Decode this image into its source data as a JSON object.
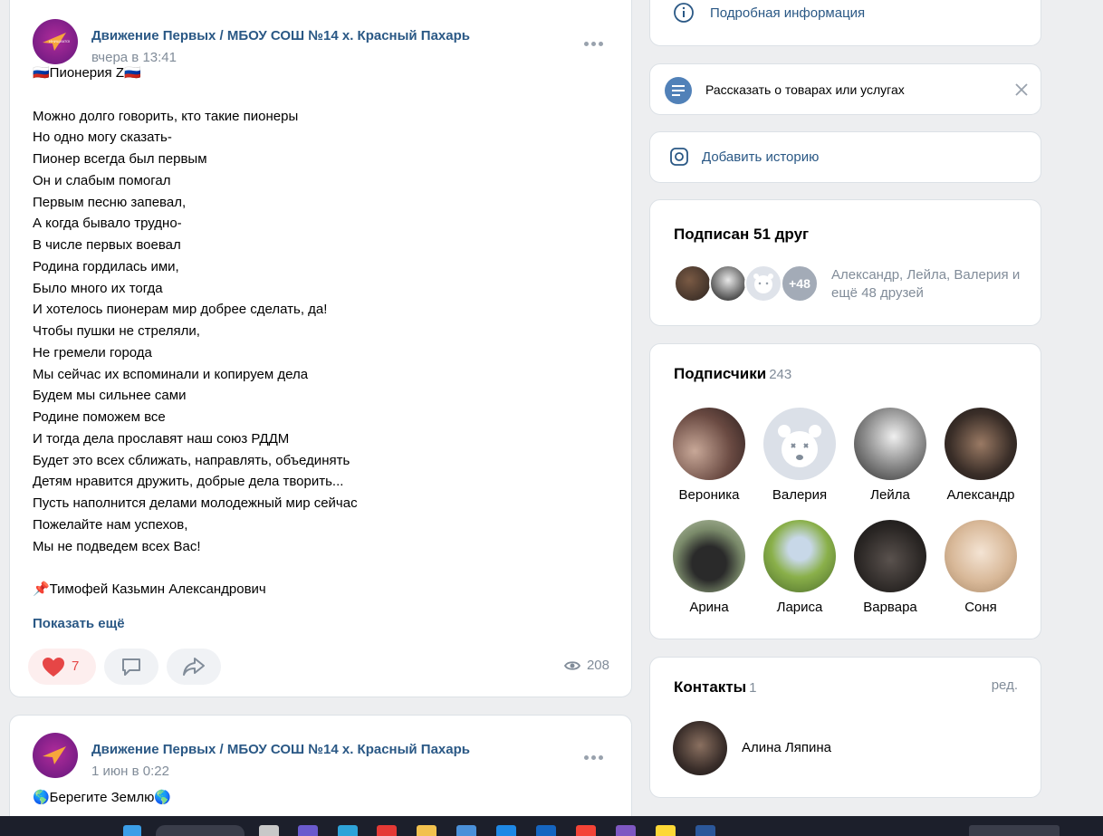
{
  "post1": {
    "group_name": "Движение Первых / МБОУ СОШ №14 х. Красный Пахарь",
    "time": "вчера в 13:41",
    "text": "🇷🇺Пионерия Z🇷🇺\n\nМожно долго говорить, кто такие пионеры\nНо одно могу сказать-\nПионер всегда был первым\nОн и слабым помогал\nПервым песню запевал,\nА когда бывало трудно-\nВ числе первых воевал\nРодина гордилась ими,\nБыло много их тогда\nИ хотелось пионерам мир добрее сделать, да!\nЧтобы пушки не стреляли,\nНе гремели города\nМы сейчас их вспоминали и копируем дела\nБудем мы сильнее сами\nРодине поможем все\nИ тогда дела прославят наш союз РДДМ\nБудет это всех сближать, направлять, объединять\nДетям нравится дружить, добрые дела творить...\nПусть наполнится делами молодежный мир сейчас\nПожелайте нам успехов,\nМы не подведем всех Вас!\n\n📌Тимофей Казьмин Александрович",
    "show_more": "Показать ещё",
    "likes": "7",
    "views": "208"
  },
  "post2": {
    "group_name": "Движение Первых / МБОУ СОШ №14 х. Красный Пахарь",
    "time": "1 июн в 0:22",
    "text": "🌎Берегите Землю🌎"
  },
  "sidebar": {
    "info_link": "Подробная информация",
    "promo_text": "Рассказать о товарах или услугах",
    "story_link": "Добавить историю",
    "friends": {
      "title": "Подписан 51 друг",
      "extra_badge": "+48",
      "names": "Александр, Лейла, Валерия и ещё 48 друзей"
    },
    "subscribers": {
      "title": "Подписчики",
      "count": "243",
      "people": [
        {
          "name": "Вероника"
        },
        {
          "name": "Валерия"
        },
        {
          "name": "Лейла"
        },
        {
          "name": "Александр"
        },
        {
          "name": "Арина"
        },
        {
          "name": "Лариса"
        },
        {
          "name": "Варвара"
        },
        {
          "name": "Соня"
        }
      ]
    },
    "contacts": {
      "title": "Контакты",
      "count": "1",
      "edit": "ред.",
      "person": "Алина Ляпина"
    }
  },
  "colors": {
    "link": "#2a5885",
    "muted": "#818c99",
    "like": "#e64646",
    "background": "#edeef0"
  }
}
